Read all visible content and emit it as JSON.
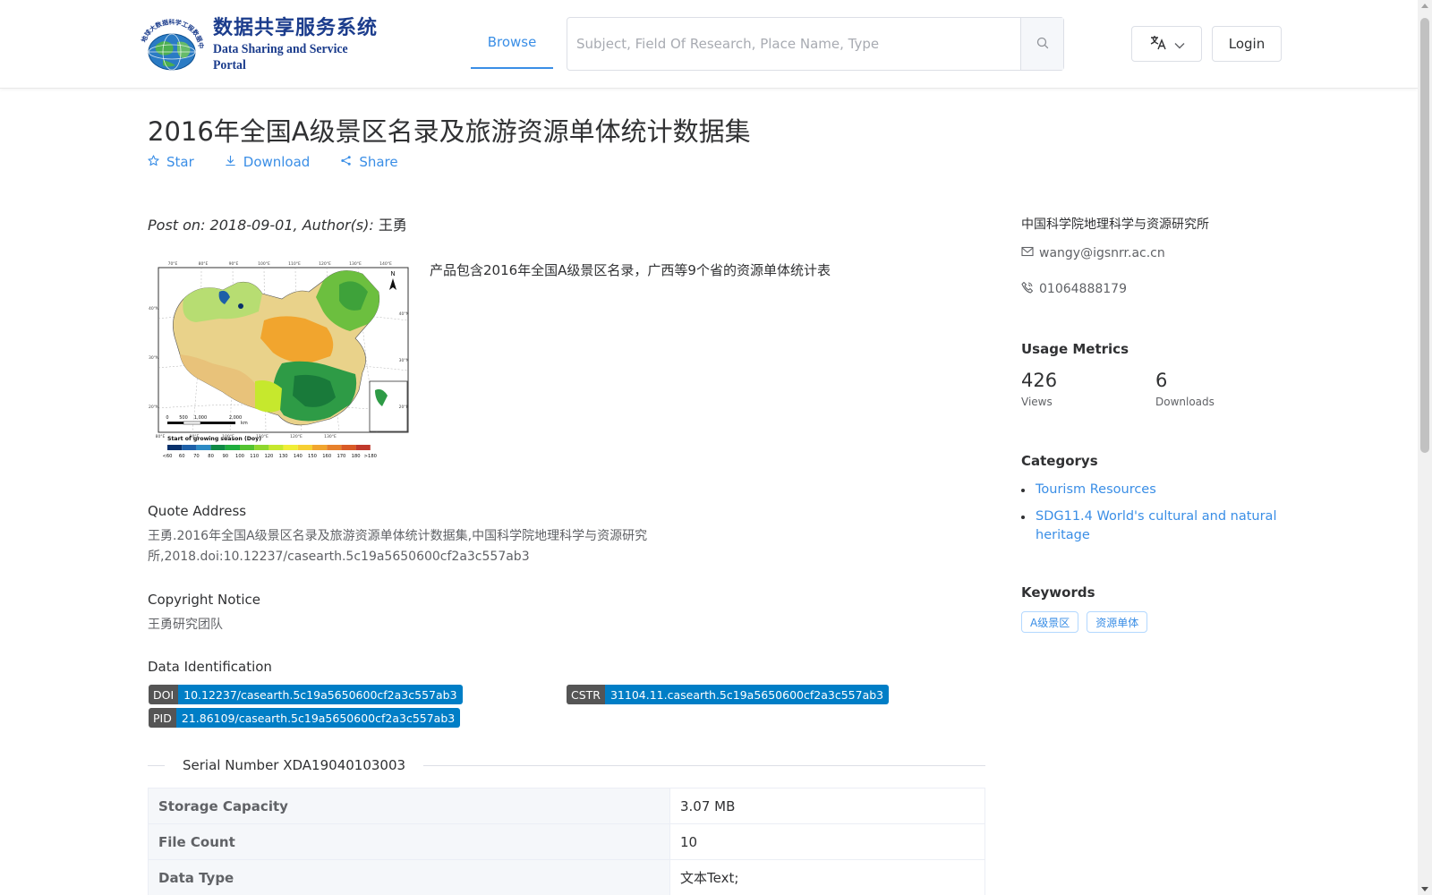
{
  "header": {
    "logo_cn": "数据共享服务系统",
    "logo_en": "Data Sharing and Service Portal",
    "logo_ring_text": "地球大数据科学工程数据中心",
    "nav_browse": "Browse",
    "search_placeholder": "Subject, Field Of Research, Place Name, Type",
    "login_label": "Login"
  },
  "dataset": {
    "title": "2016年全国A级景区名录及旅游资源单体统计数据集",
    "actions": {
      "star": "Star",
      "download": "Download",
      "share": "Share"
    },
    "post_prefix": "Post on: 2018-09-01, Author(s): ",
    "author": "王勇",
    "description": "产品包含2016年全国A级景区名录，广西等9个省的资源单体统计表",
    "quote_label": "Quote Address",
    "quote_text": "王勇.2016年全国A级景区名录及旅游资源单体统计数据集,中国科学院地理科学与资源研究所,2018.doi:10.12237/casearth.5c19a5650600cf2a3c557ab3",
    "copyright_label": "Copyright Notice",
    "copyright_text": "王勇研究团队",
    "identification_label": "Data Identification",
    "identifiers": {
      "doi_key": "DOI",
      "doi_val": "10.12237/casearth.5c19a5650600cf2a3c557ab3",
      "cstr_key": "CSTR",
      "cstr_val": "31104.11.casearth.5c19a5650600cf2a3c557ab3",
      "pid_key": "PID",
      "pid_val": "21.86109/casearth.5c19a5650600cf2a3c557ab3"
    },
    "serial_number": "Serial Number XDA19040103003",
    "table": [
      {
        "key": "Storage Capacity",
        "value": "3.07 MB"
      },
      {
        "key": "File Count",
        "value": "10"
      },
      {
        "key": "Data Type",
        "value": "文本Text;"
      }
    ]
  },
  "thumbnail": {
    "legend_title": "Start of growing season (Doy)",
    "legend_ticks": [
      "<60",
      "60",
      "70",
      "80",
      "90",
      "100",
      "110",
      "120",
      "130",
      "140",
      "150",
      "160",
      "170",
      "180",
      ">180"
    ],
    "scale_labels": [
      "0",
      "500",
      "1,000",
      "2,000"
    ],
    "scale_unit": "km",
    "north": "N",
    "lon_ticks": [
      "70°E",
      "80°E",
      "90°E",
      "100°E",
      "110°E",
      "120°E",
      "130°E",
      "140°E"
    ],
    "lon_ticks_bottom": [
      "80°E",
      "90°E",
      "100°E",
      "110°E",
      "120°E",
      "130°E"
    ],
    "lat_ticks_left": [
      "40°N",
      "30°N",
      "20°N"
    ],
    "lat_ticks_right": [
      "40°N",
      "30°N",
      "20°N"
    ],
    "legend_colors": [
      "#08306b",
      "#1d5fa8",
      "#2c8ac4",
      "#0f8a45",
      "#1fae3e",
      "#53c330",
      "#8fd72e",
      "#c6e82d",
      "#f0ee36",
      "#f6cf33",
      "#f1a52e",
      "#e7812b",
      "#d95a26",
      "#c0392b"
    ]
  },
  "sidebar": {
    "organization": "中国科学院地理科学与资源研究所",
    "email": "wangy@igsnrr.ac.cn",
    "phone": "01064888179",
    "usage_title": "Usage Metrics",
    "views_count": "426",
    "views_label": "Views",
    "downloads_count": "6",
    "downloads_label": "Downloads",
    "categories_title": "Categorys",
    "categories": [
      "Tourism Resources",
      "SDG11.4 World's cultural and natural heritage"
    ],
    "keywords_title": "Keywords",
    "keywords": [
      "A级景区",
      "资源单体"
    ]
  },
  "colors": {
    "accent": "#3a8ee6",
    "badge_key": "#555555",
    "badge_value": "#007ec6"
  }
}
